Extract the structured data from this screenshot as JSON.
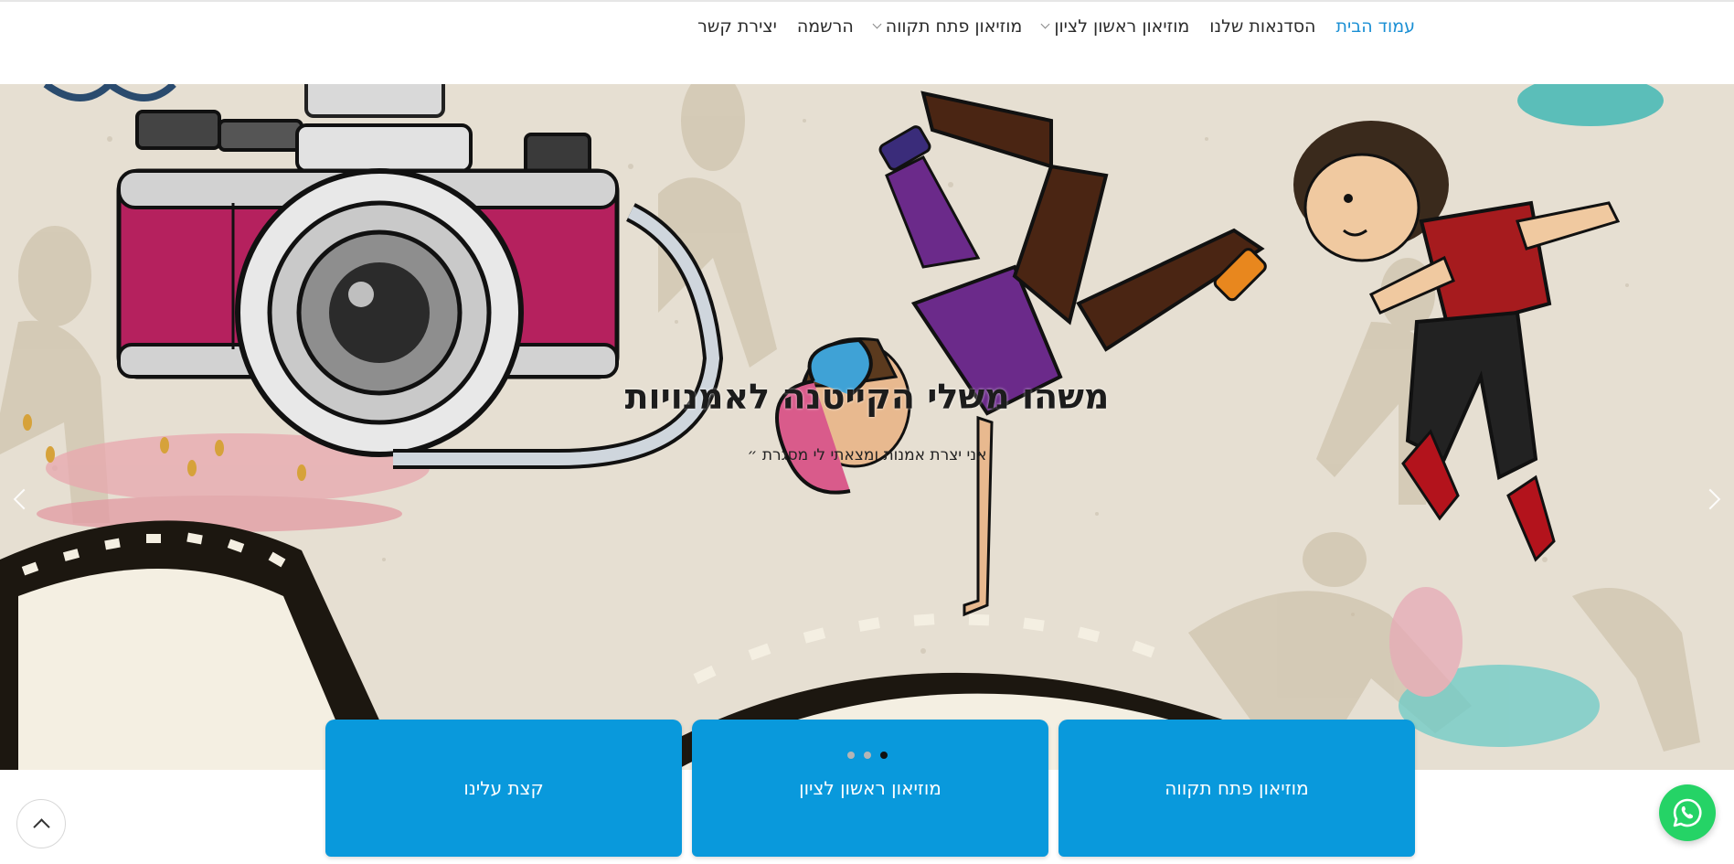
{
  "nav": {
    "items": [
      {
        "label": "עמוד הבית",
        "active": true,
        "dropdown": false
      },
      {
        "label": "הסדנאות שלנו",
        "active": false,
        "dropdown": false
      },
      {
        "label": "מוזיאון ראשון לציון",
        "active": false,
        "dropdown": true
      },
      {
        "label": "מוזיאון פתח תקווה",
        "active": false,
        "dropdown": true
      },
      {
        "label": "הרשמה",
        "active": false,
        "dropdown": false
      },
      {
        "label": "יצירת קשר",
        "active": false,
        "dropdown": false
      }
    ]
  },
  "hero": {
    "title": "משהו משלי הקייטנה לאמנויות",
    "subtitle": "אני יצרת אמנות ומצאתי לי מסגרת ״",
    "dots": 3,
    "active_dot": 3
  },
  "boxes": [
    {
      "label": "קצת עלינו"
    },
    {
      "label": "מוזיאון ראשון לציון"
    },
    {
      "label": "מוזיאון פתח תקווה"
    }
  ],
  "colors": {
    "accent": "#0999dc",
    "nav_active": "#1a8fd4",
    "whatsapp": "#25d366"
  },
  "icons": {
    "scroll_top": "chevron-up-icon",
    "whatsapp": "whatsapp-icon"
  }
}
